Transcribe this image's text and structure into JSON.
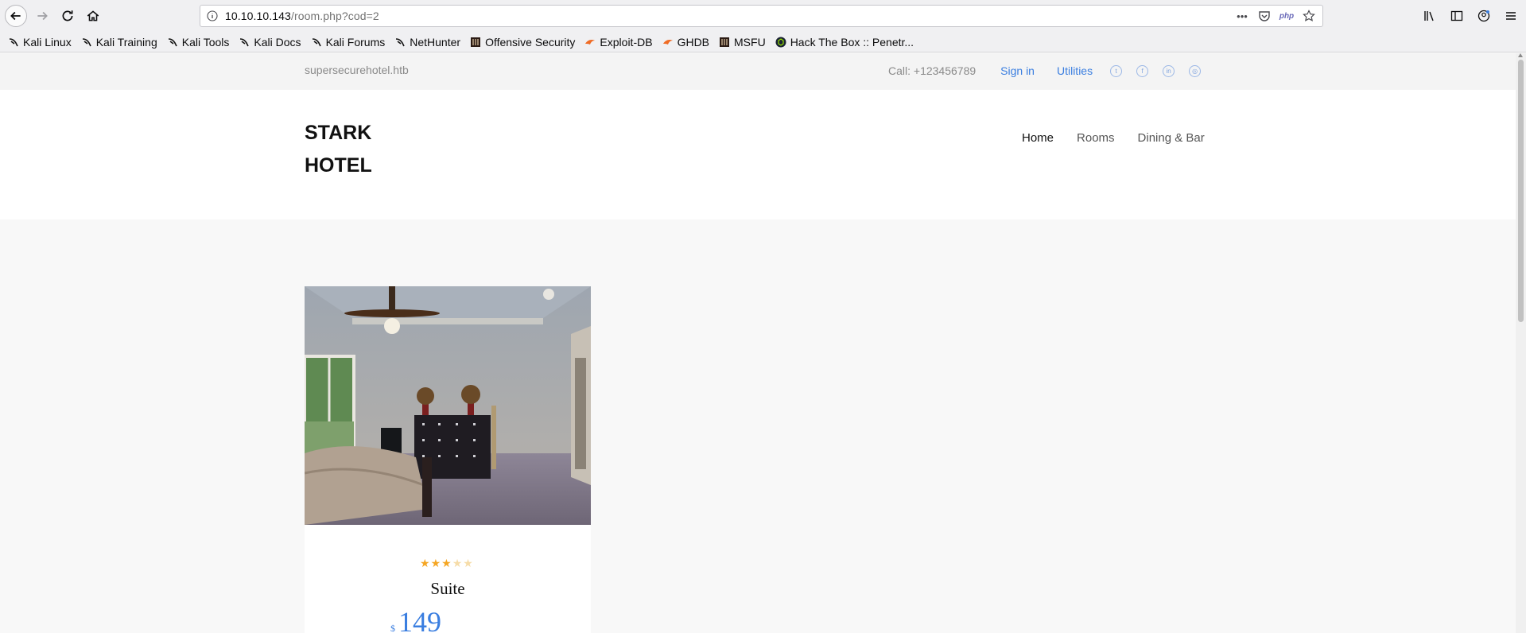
{
  "browser": {
    "url_host": "10.10.10.143",
    "url_path": "/room.php?cod=2",
    "php_badge": "php"
  },
  "bookmarks": [
    {
      "label": "Kali Linux",
      "icon": "kali-icon"
    },
    {
      "label": "Kali Training",
      "icon": "kali-icon"
    },
    {
      "label": "Kali Tools",
      "icon": "kali-icon"
    },
    {
      "label": "Kali Docs",
      "icon": "kali-icon"
    },
    {
      "label": "Kali Forums",
      "icon": "kali-icon"
    },
    {
      "label": "NetHunter",
      "icon": "kali-icon"
    },
    {
      "label": "Offensive Security",
      "icon": "offsec-icon"
    },
    {
      "label": "Exploit-DB",
      "icon": "exploitdb-icon"
    },
    {
      "label": "GHDB",
      "icon": "exploitdb-icon"
    },
    {
      "label": "MSFU",
      "icon": "offsec-icon"
    },
    {
      "label": "Hack The Box :: Penetr...",
      "icon": "htb-icon"
    }
  ],
  "topbar": {
    "site_name": "supersecurehotel.htb",
    "call": "Call: +123456789",
    "signin": "Sign in",
    "utilities": "Utilities",
    "social": [
      "twitter-icon",
      "facebook-icon",
      "linkedin-icon",
      "instagram-icon"
    ]
  },
  "header": {
    "logo_line1": "STARK",
    "logo_line2": "HOTEL",
    "menu": [
      "Home",
      "Rooms",
      "Dining & Bar"
    ]
  },
  "room": {
    "rating": 3,
    "max_rating": 5,
    "name": "Suite",
    "currency": "$",
    "price": "149"
  },
  "colors": {
    "accent": "#3a7ee0",
    "star": "#f5a623"
  }
}
